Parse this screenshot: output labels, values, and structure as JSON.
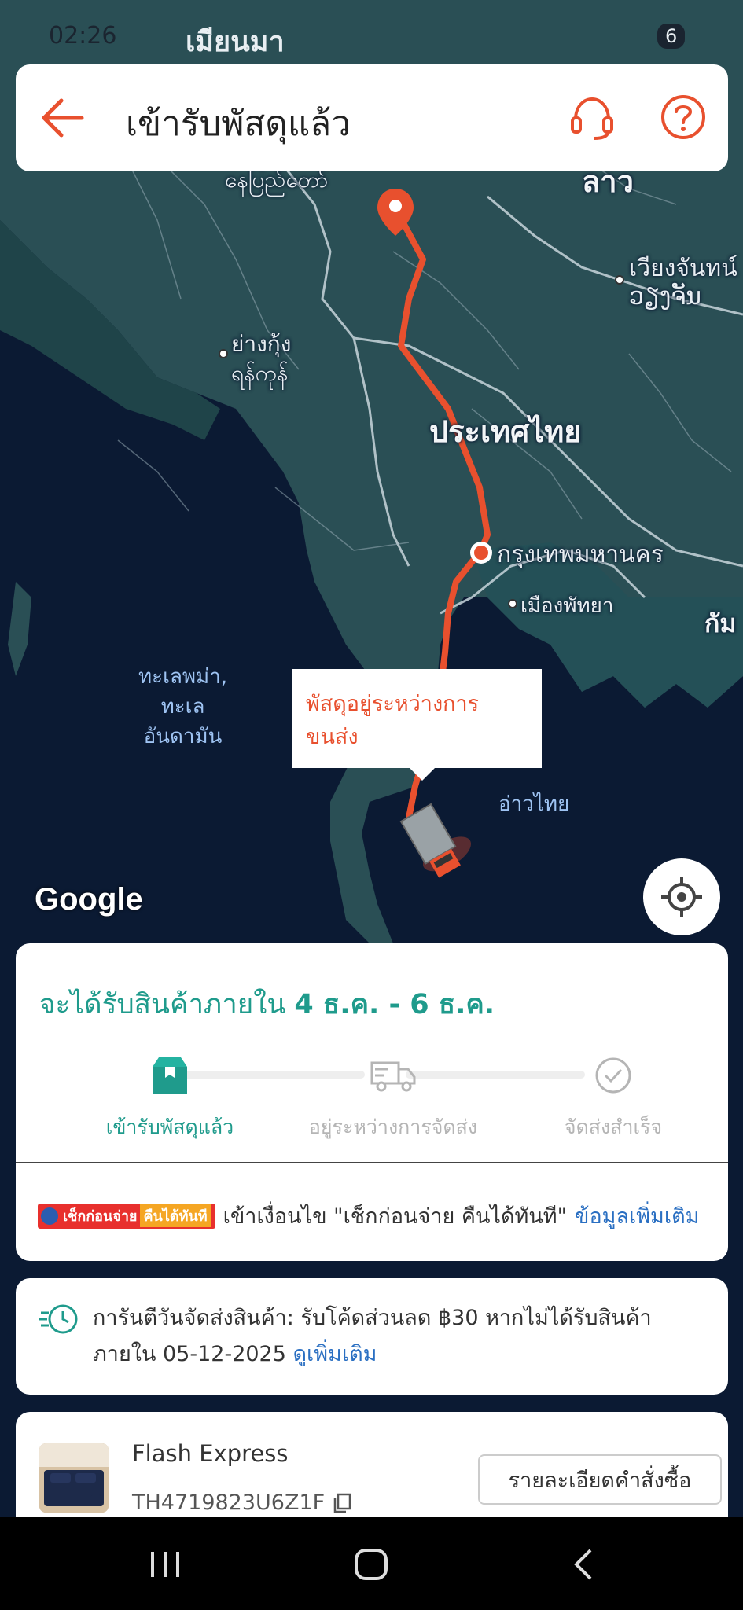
{
  "status_bar": {
    "time": "02:26",
    "map_overlay_label": "เมียนมา",
    "indicator": "6"
  },
  "header": {
    "title": "เข้ารับพัสดุแล้ว",
    "back_icon": "arrow-left-icon",
    "support_icon": "headset-icon",
    "help_icon": "question-circle-icon",
    "accent_color": "#e8502e"
  },
  "map": {
    "labels": {
      "naypyidaw": "နေပြည်တော်",
      "laos": "ลาว",
      "vientiane_th": "เวียงจันทน์",
      "vientiane_lo": "ວຽງຈັນ",
      "yangon_th": "ย่างกุ้ง",
      "yangon_my": "ရန်ကုန်",
      "thailand": "ประเทศไทย",
      "bangkok": "กรุงเทพมหานคร",
      "pattaya": "เมืองพัทยา",
      "cambodia_partial": "กัม",
      "andaman_sea": "ทะเลพม่า,\nทะเล\nอันดามัน",
      "gulf_of_thailand": "อ่าวไทย"
    },
    "tooltip": "พัสดุอยู่ระหว่างการขนส่ง",
    "google_logo": "Google",
    "locate_icon": "crosshair-icon",
    "route_color": "#e8502e"
  },
  "delivery": {
    "eta_prefix": "จะได้รับสินค้าภายใน ",
    "eta_range": "4 ธ.ค. - 6 ธ.ค.",
    "steps": [
      {
        "label": "เข้ารับพัสดุแล้ว",
        "icon": "box-icon",
        "active": true
      },
      {
        "label": "อยู่ระหว่างการจัดส่ง",
        "icon": "truck-icon",
        "active": false
      },
      {
        "label": "จัดส่งสำเร็จ",
        "icon": "check-circle-icon",
        "active": false
      }
    ],
    "promo_badge_text": "เช็กก่อนจ่าย",
    "promo_badge_highlight": "คืนได้ทันที",
    "promo_text": "เข้าเงื่อนไข \"เช็กก่อนจ่าย คืนได้ทันที\"",
    "promo_more": "ข้อมูลเพิ่มเติม",
    "accent_color": "#1f9b8c"
  },
  "guarantee": {
    "icon": "clock-fast-icon",
    "text": "การันตีวันจัดส่งสินค้า: รับโค้ดส่วนลด ฿30 หากไม่ได้รับสินค้าภายใน 05-12-2025 ",
    "more": "ดูเพิ่มเติม"
  },
  "order": {
    "courier": "Flash Express",
    "tracking_number": "TH4719823U6Z1F",
    "detail_button": "รายละเอียดคำสั่งซื้อ"
  },
  "navbar": {
    "recent_icon": "recent-apps-icon",
    "home_icon": "home-icon",
    "back_icon": "back-chevron-icon"
  }
}
